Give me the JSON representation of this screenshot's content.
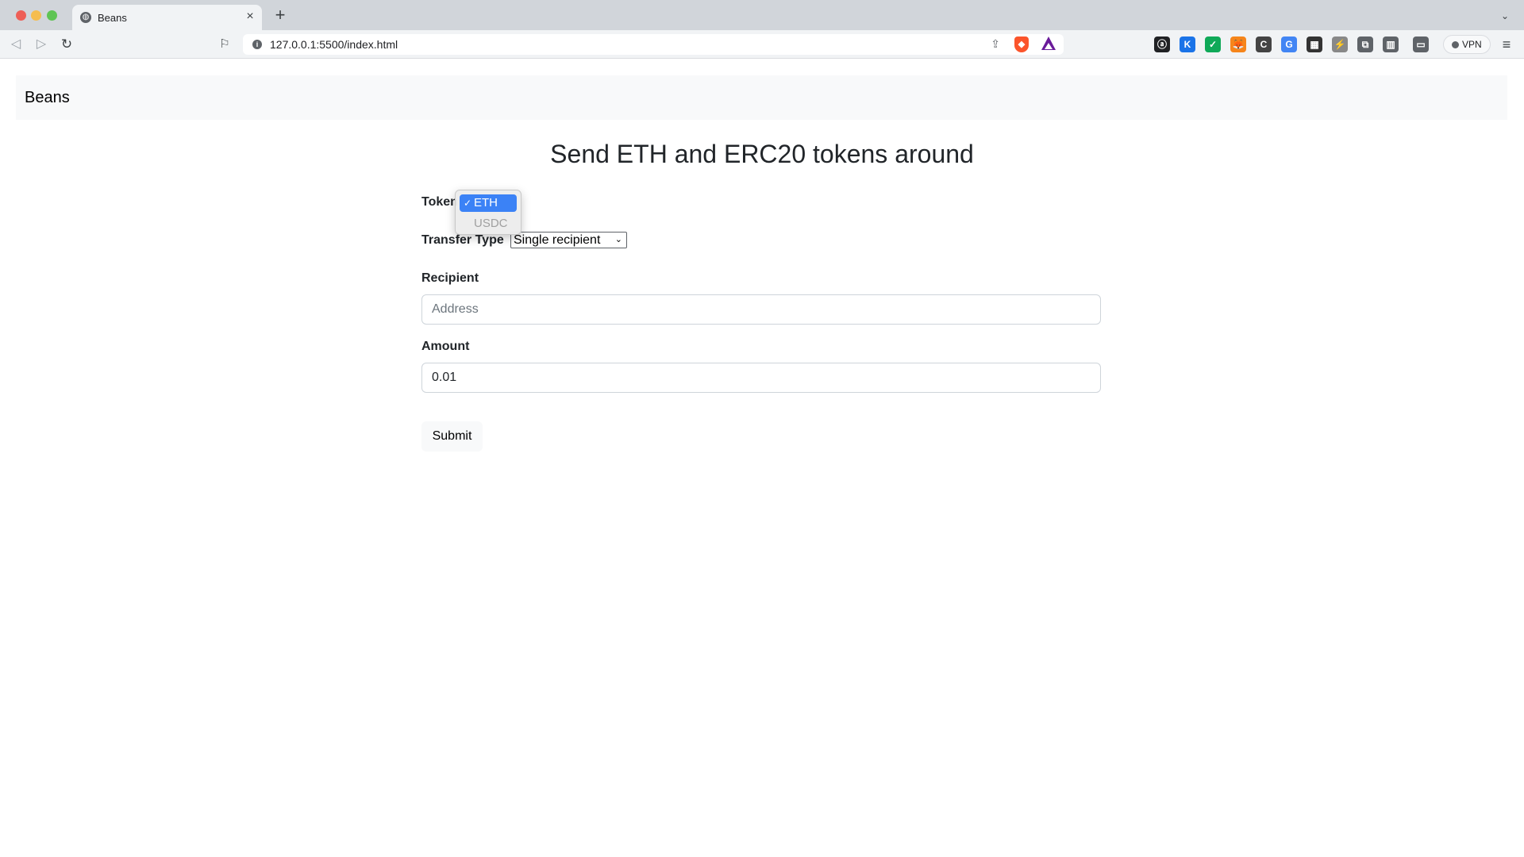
{
  "browser": {
    "tab": {
      "title": "Beans",
      "favicon": "globe-icon",
      "close": "×"
    },
    "new_tab": "+",
    "tabs_menu": "⌄",
    "url": "127.0.0.1:5500/index.html",
    "vpn_label": "VPN",
    "extensions": [
      {
        "name": "a-extension-icon",
        "glyph": "ⓐ",
        "color": "#202124"
      },
      {
        "name": "k-extension-icon",
        "glyph": "K",
        "color": "#1a73e8"
      },
      {
        "name": "green-extension-icon",
        "glyph": "✓",
        "color": "#0fa958"
      },
      {
        "name": "metamask-fox-icon",
        "glyph": "🦊",
        "color": "#f6851b"
      },
      {
        "name": "c-extension-icon",
        "glyph": "C",
        "color": "#444444"
      },
      {
        "name": "translate-icon",
        "glyph": "G",
        "color": "#4285f4"
      },
      {
        "name": "grid-extension-icon",
        "glyph": "▦",
        "color": "#333333"
      },
      {
        "name": "lightning-extension-icon",
        "glyph": "⚡",
        "color": "#888888"
      },
      {
        "name": "puzzle-extensions-icon",
        "glyph": "⧉",
        "color": "#5f6368"
      },
      {
        "name": "sidebar-icon",
        "glyph": "▥",
        "color": "#5f6368"
      },
      {
        "name": "wallet-icon",
        "glyph": "▭",
        "color": "#5f6368"
      }
    ]
  },
  "page": {
    "brand": "Beans",
    "heading": "Send ETH and ERC20 tokens around",
    "form": {
      "token_label": "Token",
      "transfer_type_label": "Transfer Type",
      "transfer_type_value": "Single recipient",
      "recipient_label": "Recipient",
      "recipient_placeholder": "Address",
      "amount_label": "Amount",
      "amount_value": "0.01",
      "submit_label": "Submit"
    },
    "token_dropdown": {
      "options": [
        {
          "label": "ETH",
          "selected": true
        },
        {
          "label": "USDC",
          "selected": false
        }
      ],
      "check": "✓"
    }
  }
}
